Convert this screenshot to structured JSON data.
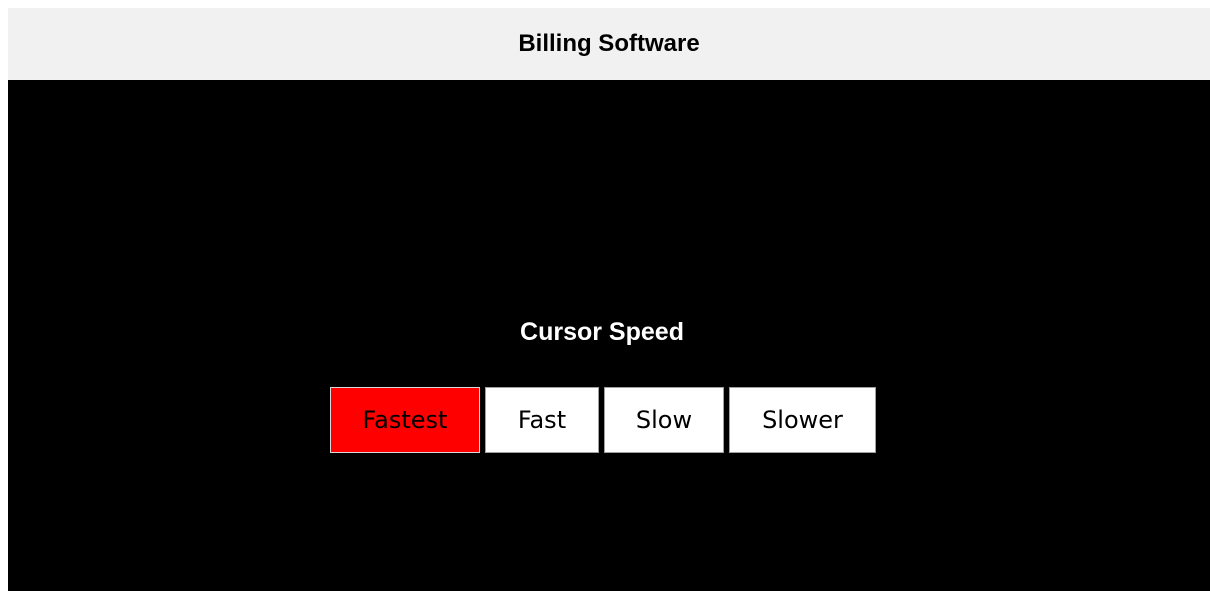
{
  "app": {
    "title": "Billing Software"
  },
  "cursor_speed": {
    "heading": "Cursor Speed",
    "selected": "Fastest",
    "options": [
      {
        "label": "Fastest",
        "selected": true
      },
      {
        "label": "Fast",
        "selected": false
      },
      {
        "label": "Slow",
        "selected": false
      },
      {
        "label": "Slower",
        "selected": false
      }
    ]
  },
  "colors": {
    "title_bar_bg": "#f1f1f1",
    "content_bg": "#000000",
    "heading_text": "#ffffff",
    "option_bg": "#ffffff",
    "option_text": "#000000",
    "selected_bg": "#ff0000"
  }
}
